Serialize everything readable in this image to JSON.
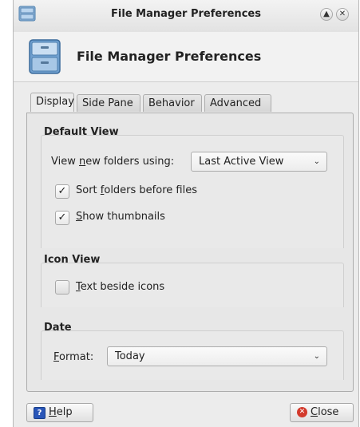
{
  "window": {
    "title": "File Manager Preferences",
    "header_title": "File Manager Preferences"
  },
  "tabs": [
    {
      "label": "Display",
      "active": true
    },
    {
      "label": "Side Pane",
      "active": false
    },
    {
      "label": "Behavior",
      "active": false
    },
    {
      "label": "Advanced",
      "active": false
    }
  ],
  "default_view": {
    "title": "Default View",
    "view_label_pre": "View ",
    "view_label_u": "n",
    "view_label_post": "ew folders using:",
    "view_value": "Last Active View",
    "sort_pre": "Sort ",
    "sort_u": "f",
    "sort_post": "olders before files",
    "sort_checked": true,
    "thumb_u": "S",
    "thumb_post": "how thumbnails",
    "thumb_checked": true
  },
  "icon_view": {
    "title": "Icon View",
    "text_u": "T",
    "text_post": "ext beside icons",
    "text_checked": false
  },
  "date": {
    "title": "Date",
    "format_u": "F",
    "format_post": "ormat:",
    "format_value": "Today"
  },
  "buttons": {
    "help_u": "H",
    "help_post": "elp",
    "close_u": "C",
    "close_post": "lose"
  },
  "icons": {
    "app": "file-cabinet-icon",
    "help": "help-icon",
    "close": "close-circle-icon"
  },
  "colors": {
    "close_icon": "#d33a2c",
    "help_icon": "#2a56b8"
  }
}
